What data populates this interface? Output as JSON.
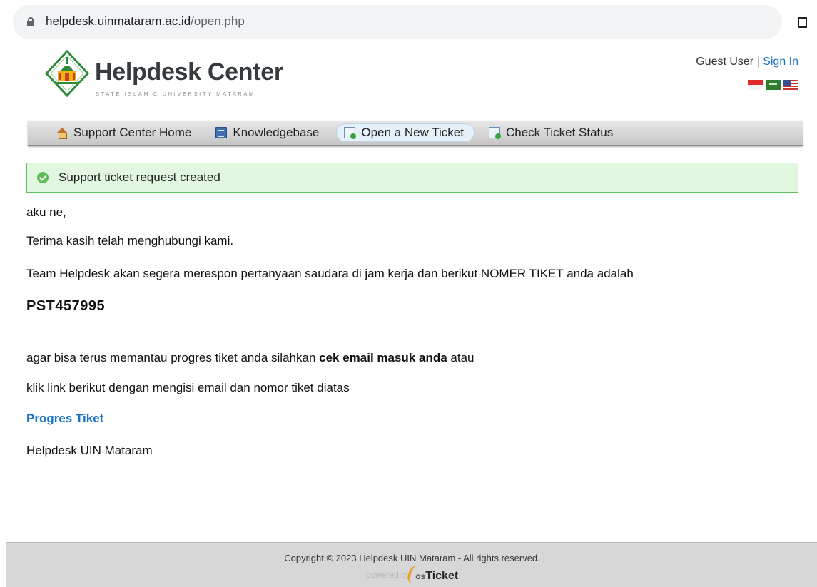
{
  "browser": {
    "domain": "helpdesk.uinmataram.ac.id",
    "path": "/open.php"
  },
  "header": {
    "logo_title": "Helpdesk Center",
    "logo_subtitle": "STATE ISLAMIC UNIVERSITY MATARAM",
    "user_label": "Guest User",
    "separator": " | ",
    "sign_in": "Sign In",
    "flags": [
      "indonesia-flag-icon",
      "saudi-arabia-flag-icon",
      "usa-flag-icon"
    ]
  },
  "nav": {
    "items": [
      {
        "label": "Support Center Home",
        "icon": "home-icon"
      },
      {
        "label": "Knowledgebase",
        "icon": "book-icon"
      },
      {
        "label": "Open a New Ticket",
        "icon": "new-ticket-icon",
        "active": true
      },
      {
        "label": "Check Ticket Status",
        "icon": "ticket-status-icon"
      }
    ]
  },
  "notice": {
    "text": "Support ticket request created",
    "color": "#5bc15a"
  },
  "message": {
    "greeting": "aku ne,",
    "thanks": "Terima kasih telah menghubungi kami.",
    "body": "Team Helpdesk akan segera merespon pertanyaan saudara di jam kerja dan berikut NOMER TIKET anda adalah",
    "ticket_number": "PST457995",
    "monitor_prefix": "agar bisa terus memantau progres tiket anda silahkan ",
    "monitor_bold": "cek email masuk anda",
    "monitor_suffix": " atau",
    "link_instruction": "klik link berikut dengan mengisi email dan nomor tiket diatas",
    "progress_link": "Progres Tiket",
    "signature": "Helpdesk UIN Mataram"
  },
  "footer": {
    "copyright": "Copyright © 2023 Helpdesk UIN Mataram - All rights reserved.",
    "powered_by": "powered by",
    "brand_os": "os",
    "brand_ticket": "Ticket"
  },
  "colors": {
    "link": "#1a73c4",
    "success_bg": "#e2f7e0",
    "footer_bg": "#d7d7d7"
  }
}
